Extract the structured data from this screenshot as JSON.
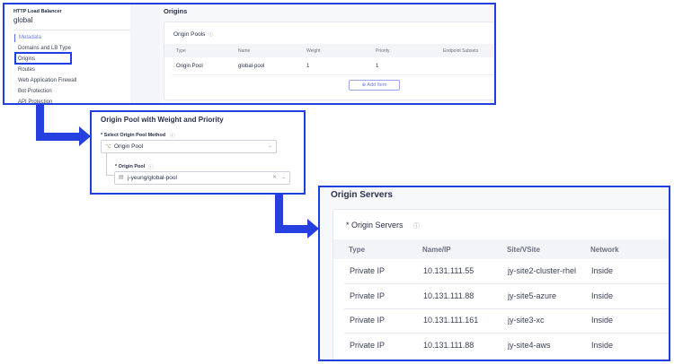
{
  "panel1": {
    "sidebar": {
      "resource_type": "HTTP Load Balancer",
      "resource_name": "global",
      "items": [
        {
          "label": "Metadata",
          "active": true
        },
        {
          "label": "Domains and LB Type"
        },
        {
          "label": "Origins",
          "highlighted": true
        },
        {
          "label": "Routes"
        },
        {
          "label": "Web Application Firewall"
        },
        {
          "label": "Bot Protection"
        },
        {
          "label": "API Protection"
        }
      ]
    },
    "section_title": "Origins",
    "card_title": "Origin Pools",
    "columns": [
      "Type",
      "Name",
      "Weight",
      "Priority",
      "Endpoint Subsets"
    ],
    "rows": [
      [
        "Origin Pool",
        "global-pool",
        "1",
        "1",
        ""
      ]
    ],
    "add_item_label": "Add Item"
  },
  "panel2": {
    "title": "Origin Pool with Weight and Priority",
    "method_label": "* Select Origin Pool Method",
    "method_value": "Origin Pool",
    "pool_label": "* Origin Pool",
    "pool_value": "j-yeung/global-pool"
  },
  "panel3": {
    "section_title": "Origin Servers",
    "card_title": "* Origin Servers",
    "columns": [
      "Type",
      "Name/IP",
      "Site/VSite",
      "Network"
    ],
    "rows": [
      [
        "Private IP",
        "10.131.111.55",
        "jy-site2-cluster-rhel",
        "Inside"
      ],
      [
        "Private IP",
        "10.131.111.88",
        "jy-site5-azure",
        "Inside"
      ],
      [
        "Private IP",
        "10.131.111.161",
        "jy-site3-xc",
        "Inside"
      ],
      [
        "Private IP",
        "10.131.111.88",
        "jy-site4-aws",
        "Inside"
      ]
    ]
  },
  "colors": {
    "highlight": "#1f3fe0",
    "accent": "#5a6cf0"
  }
}
